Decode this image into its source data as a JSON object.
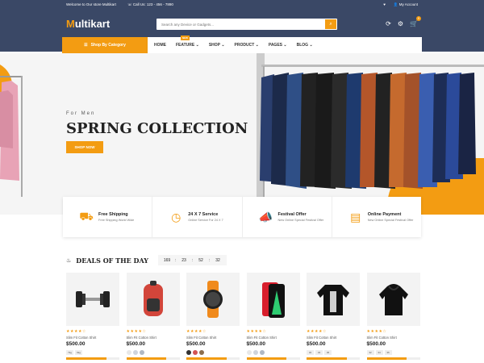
{
  "topbar": {
    "welcome": "Welcome to Our store Multikart",
    "call": "Call Us: 123 - 456 - 7890",
    "account": "My Account"
  },
  "logo": {
    "m": "M",
    "rest": "ultikart"
  },
  "search": {
    "placeholder": "Search any Device or Gadgets..."
  },
  "cart": {
    "count": "0"
  },
  "category_button": "Shop By Category",
  "menu": {
    "home": "HOME",
    "feature": "FEATURE",
    "feature_badge": "NEW",
    "shop": "SHOP",
    "product": "PRODUCT",
    "pages": "PAGES",
    "blog": "BLOG"
  },
  "hero": {
    "subtitle": "For Men",
    "title": "SPRING COLLECTION",
    "button": "SHOP NOW"
  },
  "services": [
    {
      "title": "Free Shipping",
      "sub": "Free Shipping World Wide"
    },
    {
      "title": "24 X 7 Service",
      "sub": "Online Service For 24 X 7"
    },
    {
      "title": "Festival Offer",
      "sub": "New Online Special Festival Offer"
    },
    {
      "title": "Online Payment",
      "sub": "New Online Special Festival Offer"
    }
  ],
  "deals": {
    "title": "DEALS OF THE DAY",
    "timer": [
      "169",
      "23",
      "52",
      "32"
    ]
  },
  "products": [
    {
      "name": "Slim Fit Cotton Shirt",
      "price": "$500.00",
      "stars": "★★★★☆",
      "sizes": [
        "7kg",
        "9kg"
      ],
      "sold": 0.75
    },
    {
      "name": "Slim Fit Cotton Shirt",
      "price": "$500.00",
      "stars": "★★★★☆",
      "colors": [
        "#e7e7e7",
        "#cfd4dc",
        "#b0b8c4"
      ],
      "sold": 0.75
    },
    {
      "name": "Slim Fit Cotton Shirt",
      "price": "$500.00",
      "stars": "★★★★☆",
      "colors": [
        "#333333",
        "#d35454",
        "#8b6e4e"
      ],
      "sold": 0.75
    },
    {
      "name": "Slim Fit Cotton Shirt",
      "price": "$500.00",
      "stars": "★★★★☆",
      "colors": [
        "#e7e7e7",
        "#cfd4dc",
        "#b0b8c4"
      ],
      "sold": 0.75
    },
    {
      "name": "Slim Fit Cotton Shirt",
      "price": "$500.00",
      "stars": "★★★★☆",
      "sizes": [
        "32",
        "34",
        "36"
      ],
      "sold": 0.75
    },
    {
      "name": "Slim Fit Cotton Shirt",
      "price": "$500.00",
      "stars": "★★★★☆",
      "sizes": [
        "32",
        "34",
        "36"
      ],
      "sold": 0.75
    }
  ],
  "colors": {
    "accent": "#f39c12",
    "header": "#3a4866"
  }
}
